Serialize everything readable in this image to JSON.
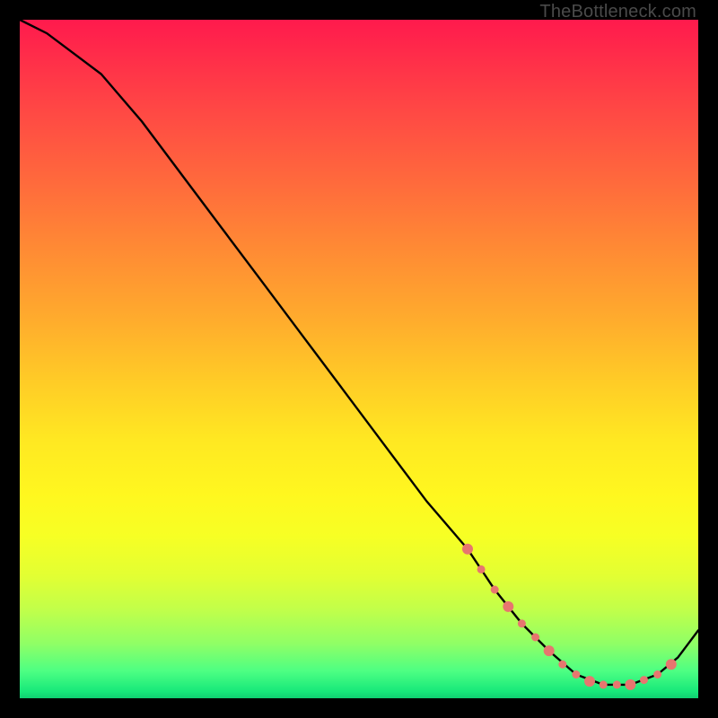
{
  "watermark": "TheBottleneck.com",
  "chart_data": {
    "type": "line",
    "title": "",
    "xlabel": "",
    "ylabel": "",
    "xlim": [
      0,
      100
    ],
    "ylim": [
      0,
      100
    ],
    "series": [
      {
        "name": "curve",
        "x": [
          0,
          4,
          8,
          12,
          18,
          24,
          30,
          36,
          42,
          48,
          54,
          60,
          66,
          70,
          74,
          78,
          82,
          86,
          90,
          94,
          97,
          100
        ],
        "y": [
          100,
          98,
          95,
          92,
          85,
          77,
          69,
          61,
          53,
          45,
          37,
          29,
          22,
          16,
          11,
          7,
          3.5,
          2,
          2,
          3.5,
          6,
          10
        ]
      }
    ],
    "markers": {
      "name": "highlight-dots",
      "color": "#e7766f",
      "x": [
        66,
        68,
        70,
        72,
        74,
        76,
        78,
        80,
        82,
        84,
        86,
        88,
        90,
        92,
        94,
        96
      ],
      "y": [
        22,
        19,
        16,
        13.5,
        11,
        9,
        7,
        5,
        3.5,
        2.5,
        2,
        2,
        2,
        2.7,
        3.5,
        5
      ]
    }
  }
}
